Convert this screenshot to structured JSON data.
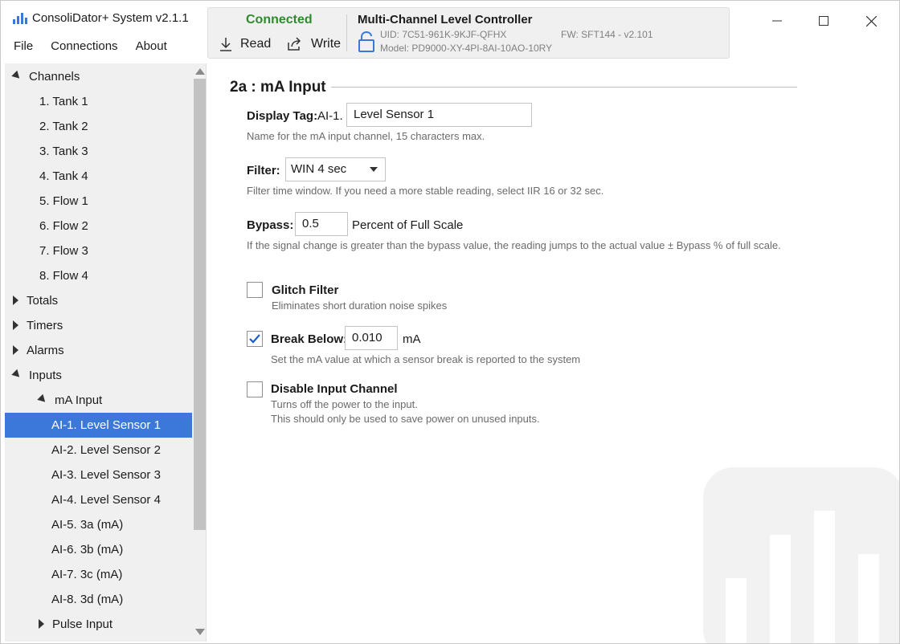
{
  "app": {
    "title": "ConsoliDator+ System v2.1.1",
    "menu": [
      "File",
      "Connections",
      "About"
    ]
  },
  "status": {
    "connection": "Connected",
    "read_label": "Read",
    "write_label": "Write",
    "device_title": "Multi-Channel Level Controller",
    "uid": "UID: 7C51-961K-9KJF-QFHX",
    "model": "Model: PD9000-XY-4PI-8AI-10AO-10RY",
    "fw": "FW: SFT144 - v2.101"
  },
  "sidebar": {
    "items": [
      {
        "label": "Channels",
        "level": 0,
        "expander": "down"
      },
      {
        "label": "1. Tank 1",
        "level": 1,
        "expander": "none"
      },
      {
        "label": "2. Tank 2",
        "level": 1,
        "expander": "none"
      },
      {
        "label": "3. Tank  3",
        "level": 1,
        "expander": "none"
      },
      {
        "label": "4. Tank 4",
        "level": 1,
        "expander": "none"
      },
      {
        "label": "5. Flow 1",
        "level": 1,
        "expander": "none"
      },
      {
        "label": "6. Flow 2",
        "level": 1,
        "expander": "none"
      },
      {
        "label": "7. Flow 3",
        "level": 1,
        "expander": "none"
      },
      {
        "label": "8. Flow 4",
        "level": 1,
        "expander": "none"
      },
      {
        "label": "Totals",
        "level": 0,
        "expander": "right"
      },
      {
        "label": "Timers",
        "level": 0,
        "expander": "right"
      },
      {
        "label": "Alarms",
        "level": 0,
        "expander": "right"
      },
      {
        "label": "Inputs",
        "level": 0,
        "expander": "down"
      },
      {
        "label": "mA Input",
        "level": 1,
        "expander": "down"
      },
      {
        "label": "AI-1. Level Sensor 1",
        "level": 2,
        "expander": "none",
        "selected": true
      },
      {
        "label": "AI-2. Level Sensor 2",
        "level": 2,
        "expander": "none"
      },
      {
        "label": "AI-3. Level Sensor 3",
        "level": 2,
        "expander": "none"
      },
      {
        "label": "AI-4. Level Sensor 4",
        "level": 2,
        "expander": "none"
      },
      {
        "label": "AI-5. 3a (mA)",
        "level": 2,
        "expander": "none"
      },
      {
        "label": "AI-6. 3b (mA)",
        "level": 2,
        "expander": "none"
      },
      {
        "label": "AI-7. 3c (mA)",
        "level": 2,
        "expander": "none"
      },
      {
        "label": "AI-8. 3d (mA)",
        "level": 2,
        "expander": "none"
      },
      {
        "label": "Pulse Input",
        "level": 1,
        "expander": "right"
      }
    ]
  },
  "main": {
    "section_title": "2a : mA Input",
    "display_tag": {
      "label": "Display Tag:",
      "prefix": "AI-1.",
      "value": "Level Sensor 1",
      "help": "Name for the mA input channel, 15 characters max."
    },
    "filter": {
      "label": "Filter:",
      "value": "WIN 4 sec",
      "help": "Filter time window. If you need a more stable reading, select IIR 16 or 32 sec."
    },
    "bypass": {
      "label": "Bypass:",
      "value": "0.5",
      "suffix": "Percent of Full Scale",
      "help": "If the signal change is greater than the bypass value, the reading jumps to the actual value ± Bypass % of full scale."
    },
    "glitch": {
      "label": "Glitch Filter",
      "checked": false,
      "help": "Eliminates short duration noise spikes"
    },
    "break_below": {
      "label": "Break Below:",
      "checked": true,
      "value": "0.010",
      "unit": "mA",
      "help": "Set the mA value at which a sensor break is reported to the system"
    },
    "disable": {
      "label": "Disable Input Channel",
      "checked": false,
      "help1": "Turns off the power to the input.",
      "help2": "This should only be used to save power on unused inputs."
    }
  },
  "colors": {
    "accent": "#3c78d8",
    "connected": "#2e8b2e",
    "sidebar_bg": "#f0f0f0"
  }
}
